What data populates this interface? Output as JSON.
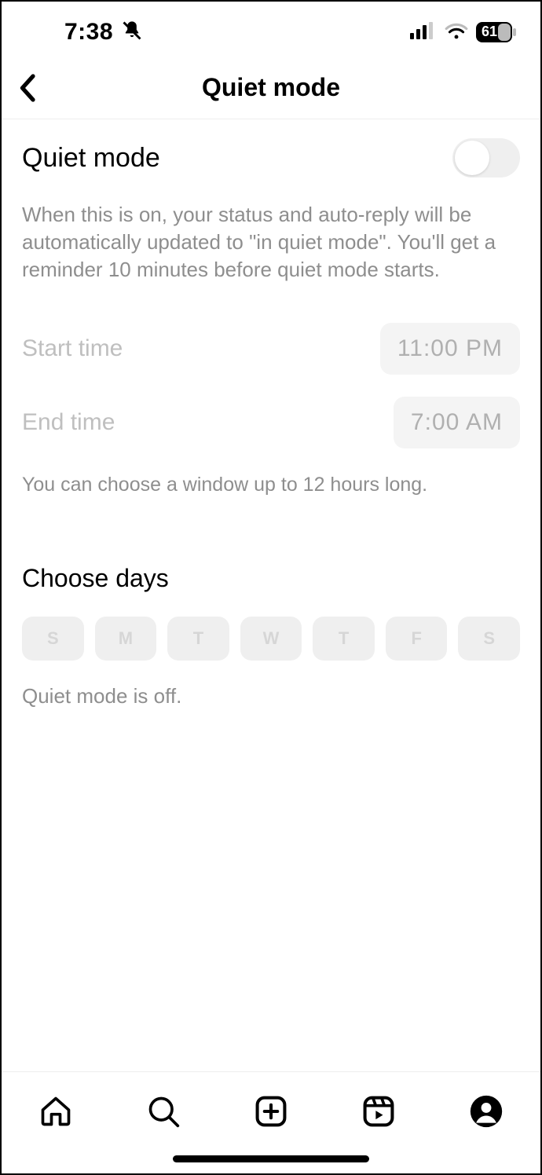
{
  "status_bar": {
    "time": "7:38",
    "battery_pct": "61"
  },
  "header": {
    "title": "Quiet mode"
  },
  "quiet_mode": {
    "label": "Quiet mode",
    "enabled": false,
    "description": "When this is on, your status and auto-reply will be automatically updated to \"in quiet mode\". You'll get a reminder 10 minutes before quiet mode starts."
  },
  "times": {
    "start_label": "Start time",
    "start_value": "11:00 PM",
    "end_label": "End time",
    "end_value": "7:00 AM",
    "hint": "You can choose a window up to 12 hours long."
  },
  "days": {
    "title": "Choose days",
    "options": [
      "S",
      "M",
      "T",
      "W",
      "T",
      "F",
      "S"
    ],
    "status": "Quiet mode is off."
  }
}
